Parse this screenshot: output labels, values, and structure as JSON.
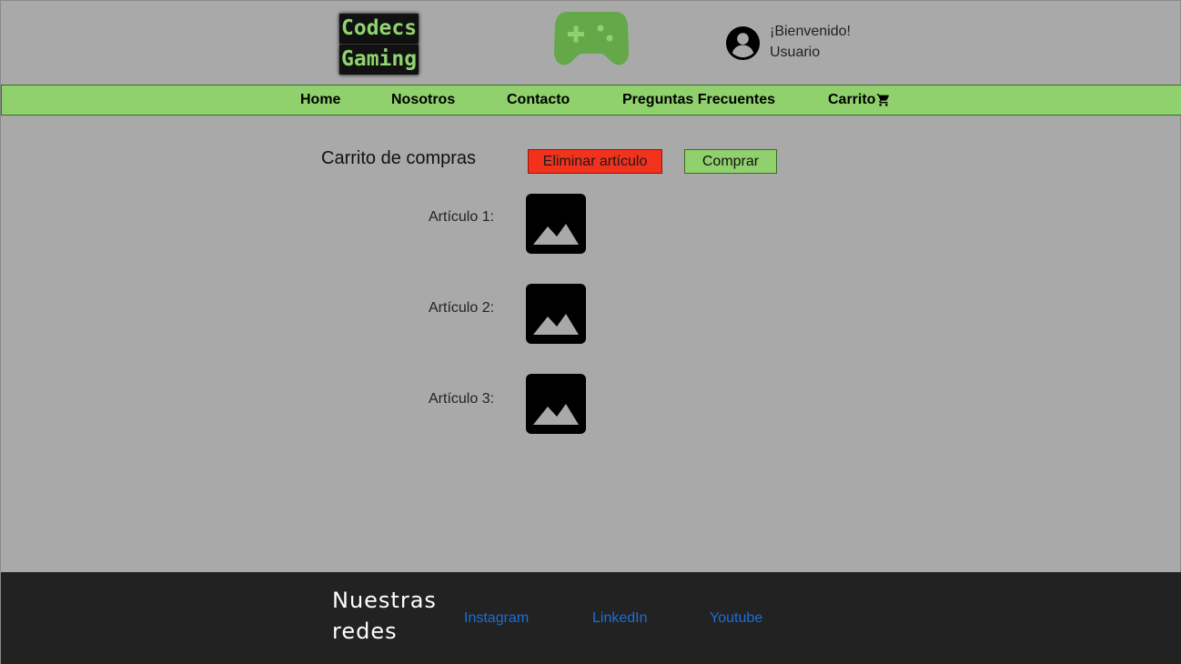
{
  "header": {
    "logo_line1": "Codecs",
    "logo_line2": "Gaming",
    "logo_icon": "gamepad-icon",
    "user_icon": "account-circle-icon",
    "welcome_line1": "¡Bienvenido!",
    "welcome_line2": "Usuario"
  },
  "nav": {
    "items": [
      {
        "label": "Home"
      },
      {
        "label": "Nosotros"
      },
      {
        "label": "Contacto"
      },
      {
        "label": "Preguntas Frecuentes"
      },
      {
        "label": "Carrito",
        "icon": "cart-icon"
      }
    ]
  },
  "cart": {
    "title": "Carrito de compras",
    "delete_label": "Eliminar artículo",
    "buy_label": "Comprar",
    "items": [
      {
        "label": "Artículo 1:",
        "icon": "image-icon"
      },
      {
        "label": "Artículo 2:",
        "icon": "image-icon"
      },
      {
        "label": "Artículo 3:",
        "icon": "image-icon"
      }
    ]
  },
  "footer": {
    "title_line1": "Nuestras",
    "title_line2": "redes",
    "links": [
      {
        "label": "Instagram"
      },
      {
        "label": "LinkedIn"
      },
      {
        "label": "Youtube"
      }
    ]
  },
  "colors": {
    "background": "#a9a9a9",
    "nav_green": "#90d16e",
    "delete_red": "#f3321d",
    "footer_dark": "#222222",
    "link_blue": "#1a6fd6"
  }
}
